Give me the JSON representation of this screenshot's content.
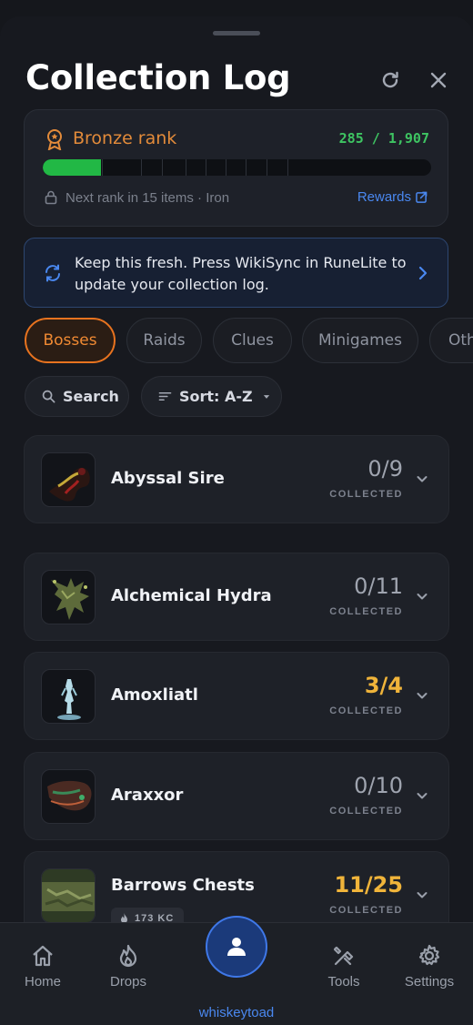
{
  "header": {
    "title": "Collection Log",
    "refresh_icon": "refresh-icon",
    "close_icon": "close-icon"
  },
  "rank": {
    "name": "Bronze rank",
    "collected": 285,
    "total": 1907,
    "count_text": "285 / 1,907",
    "progress_fraction": 0.15,
    "next_rank_text": "Next rank in 15 items · Iron",
    "rewards_label": "Rewards",
    "colors": {
      "rank": "#e38b3a",
      "count": "#3ec462",
      "bar": "#22b845",
      "link": "#4a88f0"
    }
  },
  "sync_banner": {
    "text": "Keep this fresh. Press WikiSync in RuneLite to update your collection log.",
    "icon": "sync-icon"
  },
  "tabs": [
    {
      "label": "Bosses",
      "active": true
    },
    {
      "label": "Raids",
      "active": false
    },
    {
      "label": "Clues",
      "active": false
    },
    {
      "label": "Minigames",
      "active": false
    },
    {
      "label": "Oth",
      "active": false
    }
  ],
  "toolbar": {
    "search_label": "Search",
    "sort_label": "Sort: A-Z"
  },
  "bosses": [
    {
      "name": "Abyssal Sire",
      "count": "0/9",
      "status": "COLLECTED",
      "partial": false
    },
    {
      "name": "Alchemical Hydra",
      "count": "0/11",
      "status": "COLLECTED",
      "partial": false
    },
    {
      "name": "Amoxliatl",
      "count": "3/4",
      "status": "COLLECTED",
      "partial": true
    },
    {
      "name": "Araxxor",
      "count": "0/10",
      "status": "COLLECTED",
      "partial": false
    },
    {
      "name": "Barrows Chests",
      "count": "11/25",
      "status": "COLLECTED",
      "partial": true,
      "kc": "173 KC"
    }
  ],
  "nav": {
    "home": "Home",
    "drops": "Drops",
    "username": "whiskeytoad",
    "tools": "Tools",
    "settings": "Settings"
  }
}
